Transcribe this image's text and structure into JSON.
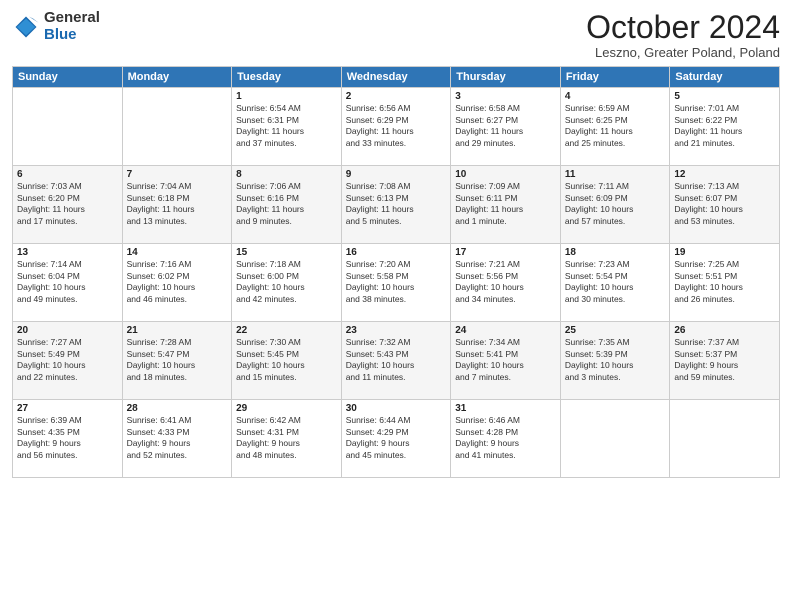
{
  "logo": {
    "general": "General",
    "blue": "Blue"
  },
  "header": {
    "month_title": "October 2024",
    "location": "Leszno, Greater Poland, Poland"
  },
  "weekdays": [
    "Sunday",
    "Monday",
    "Tuesday",
    "Wednesday",
    "Thursday",
    "Friday",
    "Saturday"
  ],
  "weeks": [
    [
      {
        "day": "",
        "info": ""
      },
      {
        "day": "",
        "info": ""
      },
      {
        "day": "1",
        "info": "Sunrise: 6:54 AM\nSunset: 6:31 PM\nDaylight: 11 hours\nand 37 minutes."
      },
      {
        "day": "2",
        "info": "Sunrise: 6:56 AM\nSunset: 6:29 PM\nDaylight: 11 hours\nand 33 minutes."
      },
      {
        "day": "3",
        "info": "Sunrise: 6:58 AM\nSunset: 6:27 PM\nDaylight: 11 hours\nand 29 minutes."
      },
      {
        "day": "4",
        "info": "Sunrise: 6:59 AM\nSunset: 6:25 PM\nDaylight: 11 hours\nand 25 minutes."
      },
      {
        "day": "5",
        "info": "Sunrise: 7:01 AM\nSunset: 6:22 PM\nDaylight: 11 hours\nand 21 minutes."
      }
    ],
    [
      {
        "day": "6",
        "info": "Sunrise: 7:03 AM\nSunset: 6:20 PM\nDaylight: 11 hours\nand 17 minutes."
      },
      {
        "day": "7",
        "info": "Sunrise: 7:04 AM\nSunset: 6:18 PM\nDaylight: 11 hours\nand 13 minutes."
      },
      {
        "day": "8",
        "info": "Sunrise: 7:06 AM\nSunset: 6:16 PM\nDaylight: 11 hours\nand 9 minutes."
      },
      {
        "day": "9",
        "info": "Sunrise: 7:08 AM\nSunset: 6:13 PM\nDaylight: 11 hours\nand 5 minutes."
      },
      {
        "day": "10",
        "info": "Sunrise: 7:09 AM\nSunset: 6:11 PM\nDaylight: 11 hours\nand 1 minute."
      },
      {
        "day": "11",
        "info": "Sunrise: 7:11 AM\nSunset: 6:09 PM\nDaylight: 10 hours\nand 57 minutes."
      },
      {
        "day": "12",
        "info": "Sunrise: 7:13 AM\nSunset: 6:07 PM\nDaylight: 10 hours\nand 53 minutes."
      }
    ],
    [
      {
        "day": "13",
        "info": "Sunrise: 7:14 AM\nSunset: 6:04 PM\nDaylight: 10 hours\nand 49 minutes."
      },
      {
        "day": "14",
        "info": "Sunrise: 7:16 AM\nSunset: 6:02 PM\nDaylight: 10 hours\nand 46 minutes."
      },
      {
        "day": "15",
        "info": "Sunrise: 7:18 AM\nSunset: 6:00 PM\nDaylight: 10 hours\nand 42 minutes."
      },
      {
        "day": "16",
        "info": "Sunrise: 7:20 AM\nSunset: 5:58 PM\nDaylight: 10 hours\nand 38 minutes."
      },
      {
        "day": "17",
        "info": "Sunrise: 7:21 AM\nSunset: 5:56 PM\nDaylight: 10 hours\nand 34 minutes."
      },
      {
        "day": "18",
        "info": "Sunrise: 7:23 AM\nSunset: 5:54 PM\nDaylight: 10 hours\nand 30 minutes."
      },
      {
        "day": "19",
        "info": "Sunrise: 7:25 AM\nSunset: 5:51 PM\nDaylight: 10 hours\nand 26 minutes."
      }
    ],
    [
      {
        "day": "20",
        "info": "Sunrise: 7:27 AM\nSunset: 5:49 PM\nDaylight: 10 hours\nand 22 minutes."
      },
      {
        "day": "21",
        "info": "Sunrise: 7:28 AM\nSunset: 5:47 PM\nDaylight: 10 hours\nand 18 minutes."
      },
      {
        "day": "22",
        "info": "Sunrise: 7:30 AM\nSunset: 5:45 PM\nDaylight: 10 hours\nand 15 minutes."
      },
      {
        "day": "23",
        "info": "Sunrise: 7:32 AM\nSunset: 5:43 PM\nDaylight: 10 hours\nand 11 minutes."
      },
      {
        "day": "24",
        "info": "Sunrise: 7:34 AM\nSunset: 5:41 PM\nDaylight: 10 hours\nand 7 minutes."
      },
      {
        "day": "25",
        "info": "Sunrise: 7:35 AM\nSunset: 5:39 PM\nDaylight: 10 hours\nand 3 minutes."
      },
      {
        "day": "26",
        "info": "Sunrise: 7:37 AM\nSunset: 5:37 PM\nDaylight: 9 hours\nand 59 minutes."
      }
    ],
    [
      {
        "day": "27",
        "info": "Sunrise: 6:39 AM\nSunset: 4:35 PM\nDaylight: 9 hours\nand 56 minutes."
      },
      {
        "day": "28",
        "info": "Sunrise: 6:41 AM\nSunset: 4:33 PM\nDaylight: 9 hours\nand 52 minutes."
      },
      {
        "day": "29",
        "info": "Sunrise: 6:42 AM\nSunset: 4:31 PM\nDaylight: 9 hours\nand 48 minutes."
      },
      {
        "day": "30",
        "info": "Sunrise: 6:44 AM\nSunset: 4:29 PM\nDaylight: 9 hours\nand 45 minutes."
      },
      {
        "day": "31",
        "info": "Sunrise: 6:46 AM\nSunset: 4:28 PM\nDaylight: 9 hours\nand 41 minutes."
      },
      {
        "day": "",
        "info": ""
      },
      {
        "day": "",
        "info": ""
      }
    ]
  ]
}
